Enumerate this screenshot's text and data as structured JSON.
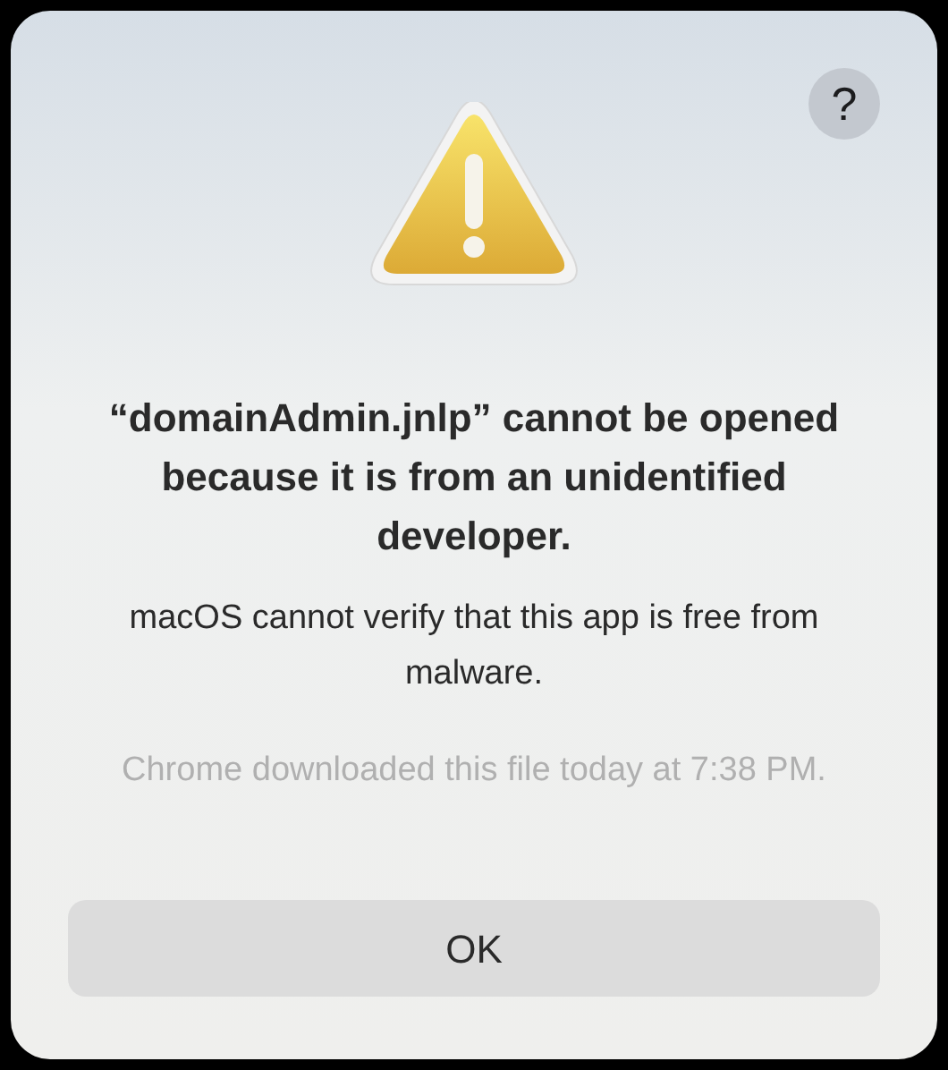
{
  "dialog": {
    "help_button": "?",
    "title": "“domainAdmin.jnlp” cannot be opened because it is from an unidentified developer.",
    "message": "macOS cannot verify that this app is free from malware.",
    "note": "Chrome downloaded this file today at 7:38 PM.",
    "buttons": [
      "OK"
    ]
  }
}
